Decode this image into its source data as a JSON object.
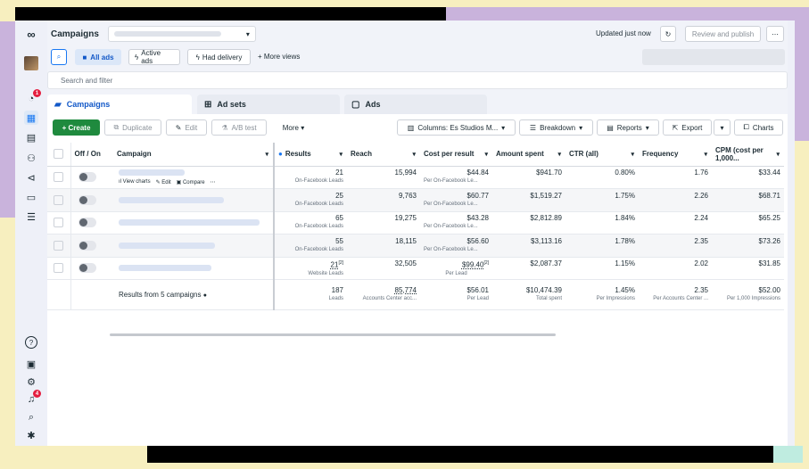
{
  "header": {
    "title": "Campaigns",
    "updated": "Updated just now",
    "review_label": "Review and publish",
    "more_label": "⋯"
  },
  "views": {
    "all_ads": "All ads",
    "active_ads": "Active ads",
    "had_delivery": "Had delivery",
    "more_views": "+ More views"
  },
  "search": {
    "placeholder": "Search and filter"
  },
  "tabs": [
    {
      "label": "Campaigns"
    },
    {
      "label": "Ad sets"
    },
    {
      "label": "Ads"
    }
  ],
  "toolbar": {
    "create": "+ Create",
    "duplicate": "Duplicate",
    "edit": "Edit",
    "ab_test": "A/B test",
    "more": "More ▾",
    "columns": "Columns: Es Studios M...",
    "breakdown": "Breakdown",
    "reports": "Reports",
    "export": "Export",
    "charts": "Charts"
  },
  "table": {
    "headers": {
      "off_on": "Off / On",
      "campaign": "Campaign",
      "results": "Results",
      "reach": "Reach",
      "cost_per_result": "Cost per result",
      "amount_spent": "Amount spent",
      "ctr": "CTR (all)",
      "frequency": "Frequency",
      "cpm": "CPM (cost per 1,000..."
    },
    "row_actions": {
      "view_charts": "View charts",
      "edit": "Edit",
      "compare": "Compare",
      "more": "⋯"
    },
    "rows": [
      {
        "results": "21",
        "results_sub": "On-Facebook Leads",
        "reach": "15,994",
        "cpr": "$44.84",
        "cpr_sub": "Per On-Facebook Le...",
        "spent": "$941.70",
        "ctr": "0.80%",
        "freq": "1.76",
        "cpm": "$33.44"
      },
      {
        "results": "25",
        "results_sub": "On-Facebook Leads",
        "reach": "9,763",
        "cpr": "$60.77",
        "cpr_sub": "Per On-Facebook Le...",
        "spent": "$1,519.27",
        "ctr": "1.75%",
        "freq": "2.26",
        "cpm": "$68.71"
      },
      {
        "results": "65",
        "results_sub": "On-Facebook Leads",
        "reach": "19,275",
        "cpr": "$43.28",
        "cpr_sub": "Per On-Facebook Le...",
        "spent": "$2,812.89",
        "ctr": "1.84%",
        "freq": "2.24",
        "cpm": "$65.25"
      },
      {
        "results": "55",
        "results_sub": "On-Facebook Leads",
        "reach": "18,115",
        "cpr": "$56.60",
        "cpr_sub": "Per On-Facebook Le...",
        "spent": "$3,113.16",
        "ctr": "1.78%",
        "freq": "2.35",
        "cpm": "$73.26"
      },
      {
        "results": "21",
        "results_sup": "[2]",
        "results_sub": "Website Leads",
        "reach": "32,505",
        "cpr": "$99.40",
        "cpr_sup": "[2]",
        "cpr_sub": "Per Lead",
        "spent": "$2,087.37",
        "ctr": "1.15%",
        "freq": "2.02",
        "cpm": "$31.85"
      }
    ],
    "totals": {
      "label": "Results from 5 campaigns",
      "results": "187",
      "results_sub": "Leads",
      "reach": "85,774",
      "reach_sub": "Accounts Center acc...",
      "cpr": "$56.01",
      "cpr_sub": "Per Lead",
      "spent": "$10,474.39",
      "spent_sub": "Total spent",
      "ctr": "1.45%",
      "ctr_sub": "Per Impressions",
      "freq": "2.35",
      "freq_sub": "Per Accounts Center ...",
      "cpm": "$52.00",
      "cpm_sub": "Per 1,000 Impressions"
    }
  },
  "rail": {
    "notif_badge": "1",
    "alert_badge": "4",
    "help_label": "?"
  },
  "colors": {
    "accent": "#1877f2",
    "create": "#1f8a3e",
    "badge": "#e41e3f"
  }
}
